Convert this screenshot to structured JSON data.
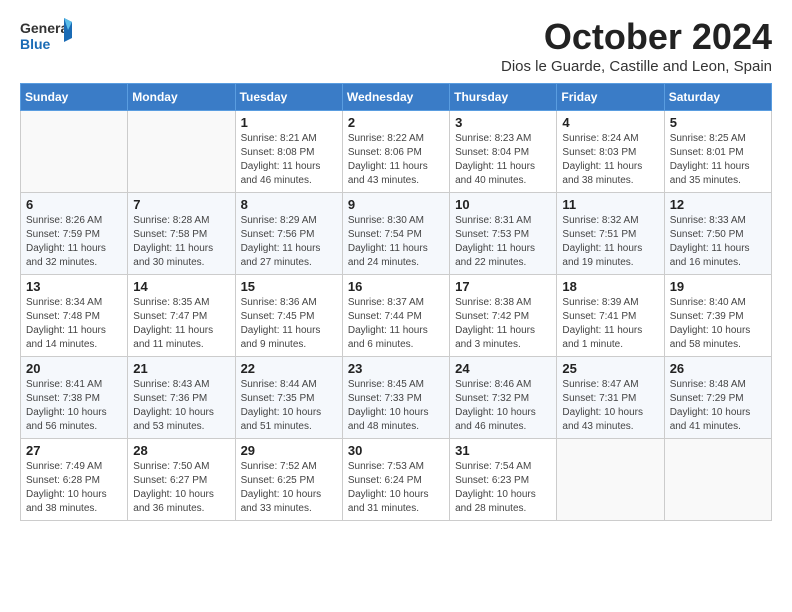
{
  "logo": {
    "line1": "General",
    "line2": "Blue"
  },
  "title": "October 2024",
  "subtitle": "Dios le Guarde, Castille and Leon, Spain",
  "days_of_week": [
    "Sunday",
    "Monday",
    "Tuesday",
    "Wednesday",
    "Thursday",
    "Friday",
    "Saturday"
  ],
  "weeks": [
    [
      {
        "day": "",
        "info": ""
      },
      {
        "day": "",
        "info": ""
      },
      {
        "day": "1",
        "info": "Sunrise: 8:21 AM\nSunset: 8:08 PM\nDaylight: 11 hours and 46 minutes."
      },
      {
        "day": "2",
        "info": "Sunrise: 8:22 AM\nSunset: 8:06 PM\nDaylight: 11 hours and 43 minutes."
      },
      {
        "day": "3",
        "info": "Sunrise: 8:23 AM\nSunset: 8:04 PM\nDaylight: 11 hours and 40 minutes."
      },
      {
        "day": "4",
        "info": "Sunrise: 8:24 AM\nSunset: 8:03 PM\nDaylight: 11 hours and 38 minutes."
      },
      {
        "day": "5",
        "info": "Sunrise: 8:25 AM\nSunset: 8:01 PM\nDaylight: 11 hours and 35 minutes."
      }
    ],
    [
      {
        "day": "6",
        "info": "Sunrise: 8:26 AM\nSunset: 7:59 PM\nDaylight: 11 hours and 32 minutes."
      },
      {
        "day": "7",
        "info": "Sunrise: 8:28 AM\nSunset: 7:58 PM\nDaylight: 11 hours and 30 minutes."
      },
      {
        "day": "8",
        "info": "Sunrise: 8:29 AM\nSunset: 7:56 PM\nDaylight: 11 hours and 27 minutes."
      },
      {
        "day": "9",
        "info": "Sunrise: 8:30 AM\nSunset: 7:54 PM\nDaylight: 11 hours and 24 minutes."
      },
      {
        "day": "10",
        "info": "Sunrise: 8:31 AM\nSunset: 7:53 PM\nDaylight: 11 hours and 22 minutes."
      },
      {
        "day": "11",
        "info": "Sunrise: 8:32 AM\nSunset: 7:51 PM\nDaylight: 11 hours and 19 minutes."
      },
      {
        "day": "12",
        "info": "Sunrise: 8:33 AM\nSunset: 7:50 PM\nDaylight: 11 hours and 16 minutes."
      }
    ],
    [
      {
        "day": "13",
        "info": "Sunrise: 8:34 AM\nSunset: 7:48 PM\nDaylight: 11 hours and 14 minutes."
      },
      {
        "day": "14",
        "info": "Sunrise: 8:35 AM\nSunset: 7:47 PM\nDaylight: 11 hours and 11 minutes."
      },
      {
        "day": "15",
        "info": "Sunrise: 8:36 AM\nSunset: 7:45 PM\nDaylight: 11 hours and 9 minutes."
      },
      {
        "day": "16",
        "info": "Sunrise: 8:37 AM\nSunset: 7:44 PM\nDaylight: 11 hours and 6 minutes."
      },
      {
        "day": "17",
        "info": "Sunrise: 8:38 AM\nSunset: 7:42 PM\nDaylight: 11 hours and 3 minutes."
      },
      {
        "day": "18",
        "info": "Sunrise: 8:39 AM\nSunset: 7:41 PM\nDaylight: 11 hours and 1 minute."
      },
      {
        "day": "19",
        "info": "Sunrise: 8:40 AM\nSunset: 7:39 PM\nDaylight: 10 hours and 58 minutes."
      }
    ],
    [
      {
        "day": "20",
        "info": "Sunrise: 8:41 AM\nSunset: 7:38 PM\nDaylight: 10 hours and 56 minutes."
      },
      {
        "day": "21",
        "info": "Sunrise: 8:43 AM\nSunset: 7:36 PM\nDaylight: 10 hours and 53 minutes."
      },
      {
        "day": "22",
        "info": "Sunrise: 8:44 AM\nSunset: 7:35 PM\nDaylight: 10 hours and 51 minutes."
      },
      {
        "day": "23",
        "info": "Sunrise: 8:45 AM\nSunset: 7:33 PM\nDaylight: 10 hours and 48 minutes."
      },
      {
        "day": "24",
        "info": "Sunrise: 8:46 AM\nSunset: 7:32 PM\nDaylight: 10 hours and 46 minutes."
      },
      {
        "day": "25",
        "info": "Sunrise: 8:47 AM\nSunset: 7:31 PM\nDaylight: 10 hours and 43 minutes."
      },
      {
        "day": "26",
        "info": "Sunrise: 8:48 AM\nSunset: 7:29 PM\nDaylight: 10 hours and 41 minutes."
      }
    ],
    [
      {
        "day": "27",
        "info": "Sunrise: 7:49 AM\nSunset: 6:28 PM\nDaylight: 10 hours and 38 minutes."
      },
      {
        "day": "28",
        "info": "Sunrise: 7:50 AM\nSunset: 6:27 PM\nDaylight: 10 hours and 36 minutes."
      },
      {
        "day": "29",
        "info": "Sunrise: 7:52 AM\nSunset: 6:25 PM\nDaylight: 10 hours and 33 minutes."
      },
      {
        "day": "30",
        "info": "Sunrise: 7:53 AM\nSunset: 6:24 PM\nDaylight: 10 hours and 31 minutes."
      },
      {
        "day": "31",
        "info": "Sunrise: 7:54 AM\nSunset: 6:23 PM\nDaylight: 10 hours and 28 minutes."
      },
      {
        "day": "",
        "info": ""
      },
      {
        "day": "",
        "info": ""
      }
    ]
  ]
}
